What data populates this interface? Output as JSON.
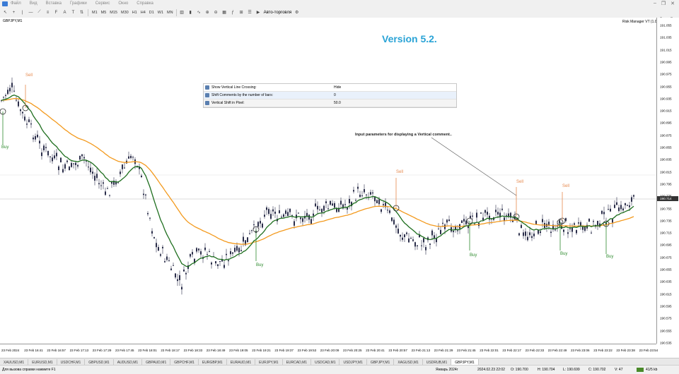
{
  "menu": {
    "items": [
      "Файл",
      "Вид",
      "Вставка",
      "Графики",
      "Сервис",
      "Окно",
      "Справка"
    ]
  },
  "toolbar": {
    "timeframes": [
      "M1",
      "M5",
      "M15",
      "M30",
      "H1",
      "H4",
      "D1",
      "W1",
      "MN"
    ],
    "auto_trading": "Авто-торговля"
  },
  "chart": {
    "symbol_label": "GBPJPY,M1",
    "indicator_label": "Risk Manager VT (1.0)",
    "version_text": "Version 5.2.",
    "annotation": "Input parameters for displaying a Vertical comment..",
    "current_price": "190.714",
    "params": [
      {
        "name": "Show Vertical Line Crossing:",
        "value": "Hide"
      },
      {
        "name": "Shift Comments by the number of bars:",
        "value": "0"
      },
      {
        "name": "Vertical Shift in Pixel:",
        "value": "50.0"
      }
    ],
    "signals": {
      "sell": "Sell",
      "buy": "Buy"
    }
  },
  "price_axis": [
    "191.055",
    "191.035",
    "191.015",
    "190.995",
    "190.975",
    "190.955",
    "190.935",
    "190.915",
    "190.895",
    "190.875",
    "190.855",
    "190.835",
    "190.815",
    "190.795",
    "190.775",
    "190.755",
    "190.735",
    "190.715",
    "190.695",
    "190.675",
    "190.655",
    "190.635",
    "190.615",
    "190.595",
    "190.575",
    "190.555",
    "190.535"
  ],
  "time_axis": [
    "23 Feb 2024",
    "23 Feb 16:41",
    "23 Feb 16:57",
    "23 Feb 17:13",
    "23 Feb 17:29",
    "23 Feb 17:45",
    "23 Feb 18:01",
    "23 Feb 18:17",
    "23 Feb 18:33",
    "23 Feb 18:49",
    "23 Feb 19:05",
    "23 Feb 19:21",
    "23 Feb 19:37",
    "23 Feb 19:53",
    "23 Feb 20:09",
    "23 Feb 20:25",
    "23 Feb 20:41",
    "23 Feb 20:57",
    "23 Feb 21:13",
    "23 Feb 21:29",
    "23 Feb 21:45",
    "23 Feb 22:01",
    "23 Feb 22:17",
    "23 Feb 22:33",
    "23 Feb 22:49",
    "23 Feb 23:06",
    "23 Feb 23:22",
    "23 Feb 23:38",
    "23 Feb 23:54"
  ],
  "tabs": [
    "XAUUSD,M1",
    "EURUSD,M1",
    "USDCHF,M1",
    "GBPUSD,M1",
    "AUDUSD,M1",
    "GBPAUD,M1",
    "GBPCHF,M1",
    "EURGBP,M1",
    "EURAUD,M1",
    "EURJPY,M1",
    "EURCAD,M1",
    "USDCAD,M1",
    "USDJPY,M1",
    "GBPJPY,M1",
    "XAGUSD,M1",
    "USDRUB,M1",
    "GBPJPY,M1"
  ],
  "active_tab_index": 16,
  "status": {
    "help": "Для вызова справки нажмите F1",
    "profile": "Январь 2024г",
    "datetime": "2024.02.23 22:02",
    "open": "O: 190.700",
    "high": "H: 190.704",
    "low": "L: 190.699",
    "close": "C: 190.702",
    "volume": "V: 47",
    "traffic": "41/5 kb"
  },
  "colors": {
    "candle": "#2b2e4a",
    "ma_fast": "#1e6e1e",
    "ma_slow": "#f39a1e",
    "sell": "#e6894e",
    "buy": "#2e8b2e",
    "version": "#29a3d6"
  }
}
